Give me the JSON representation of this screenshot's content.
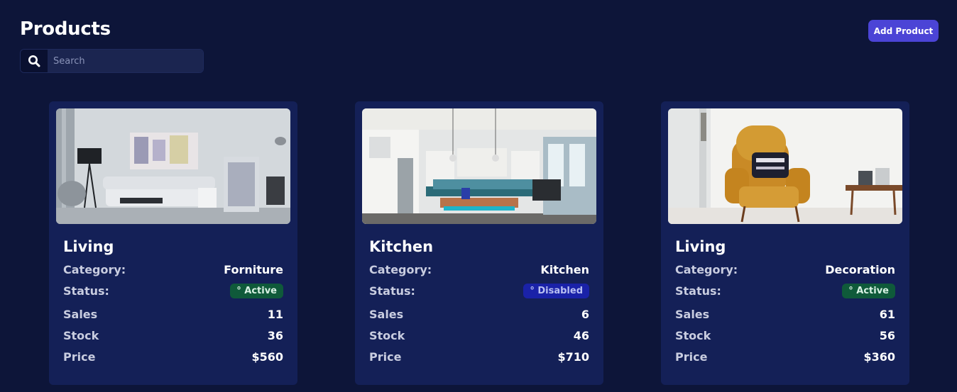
{
  "header": {
    "title": "Products",
    "add_button_label": "Add Product"
  },
  "search": {
    "placeholder": "Search",
    "value": "",
    "icon": "search-icon"
  },
  "colors": {
    "background": "#0d1539",
    "card": "#142057",
    "accent": "#4b44d6",
    "active_badge": "#0f5a3a",
    "disabled_badge": "#1a22a8"
  },
  "products": [
    {
      "title": "Living",
      "category_label": "Category:",
      "category": "Forniture",
      "status_label": "Status:",
      "status": "° Active",
      "sales_label": "Sales",
      "sales": "11",
      "stock_label": "Stock",
      "stock": "36",
      "price_label": "Price",
      "price": "$560"
    },
    {
      "title": "Kitchen",
      "category_label": "Category:",
      "category": "Kitchen",
      "status_label": "Status:",
      "status": "° Disabled",
      "sales_label": "Sales",
      "sales": "6",
      "stock_label": "Stock",
      "stock": "46",
      "price_label": "Price",
      "price": "$710"
    },
    {
      "title": "Living",
      "category_label": "Category:",
      "category": "Decoration",
      "status_label": "Status:",
      "status": "° Active",
      "sales_label": "Sales",
      "sales": "61",
      "stock_label": "Stock",
      "stock": "56",
      "price_label": "Price",
      "price": "$360"
    }
  ]
}
